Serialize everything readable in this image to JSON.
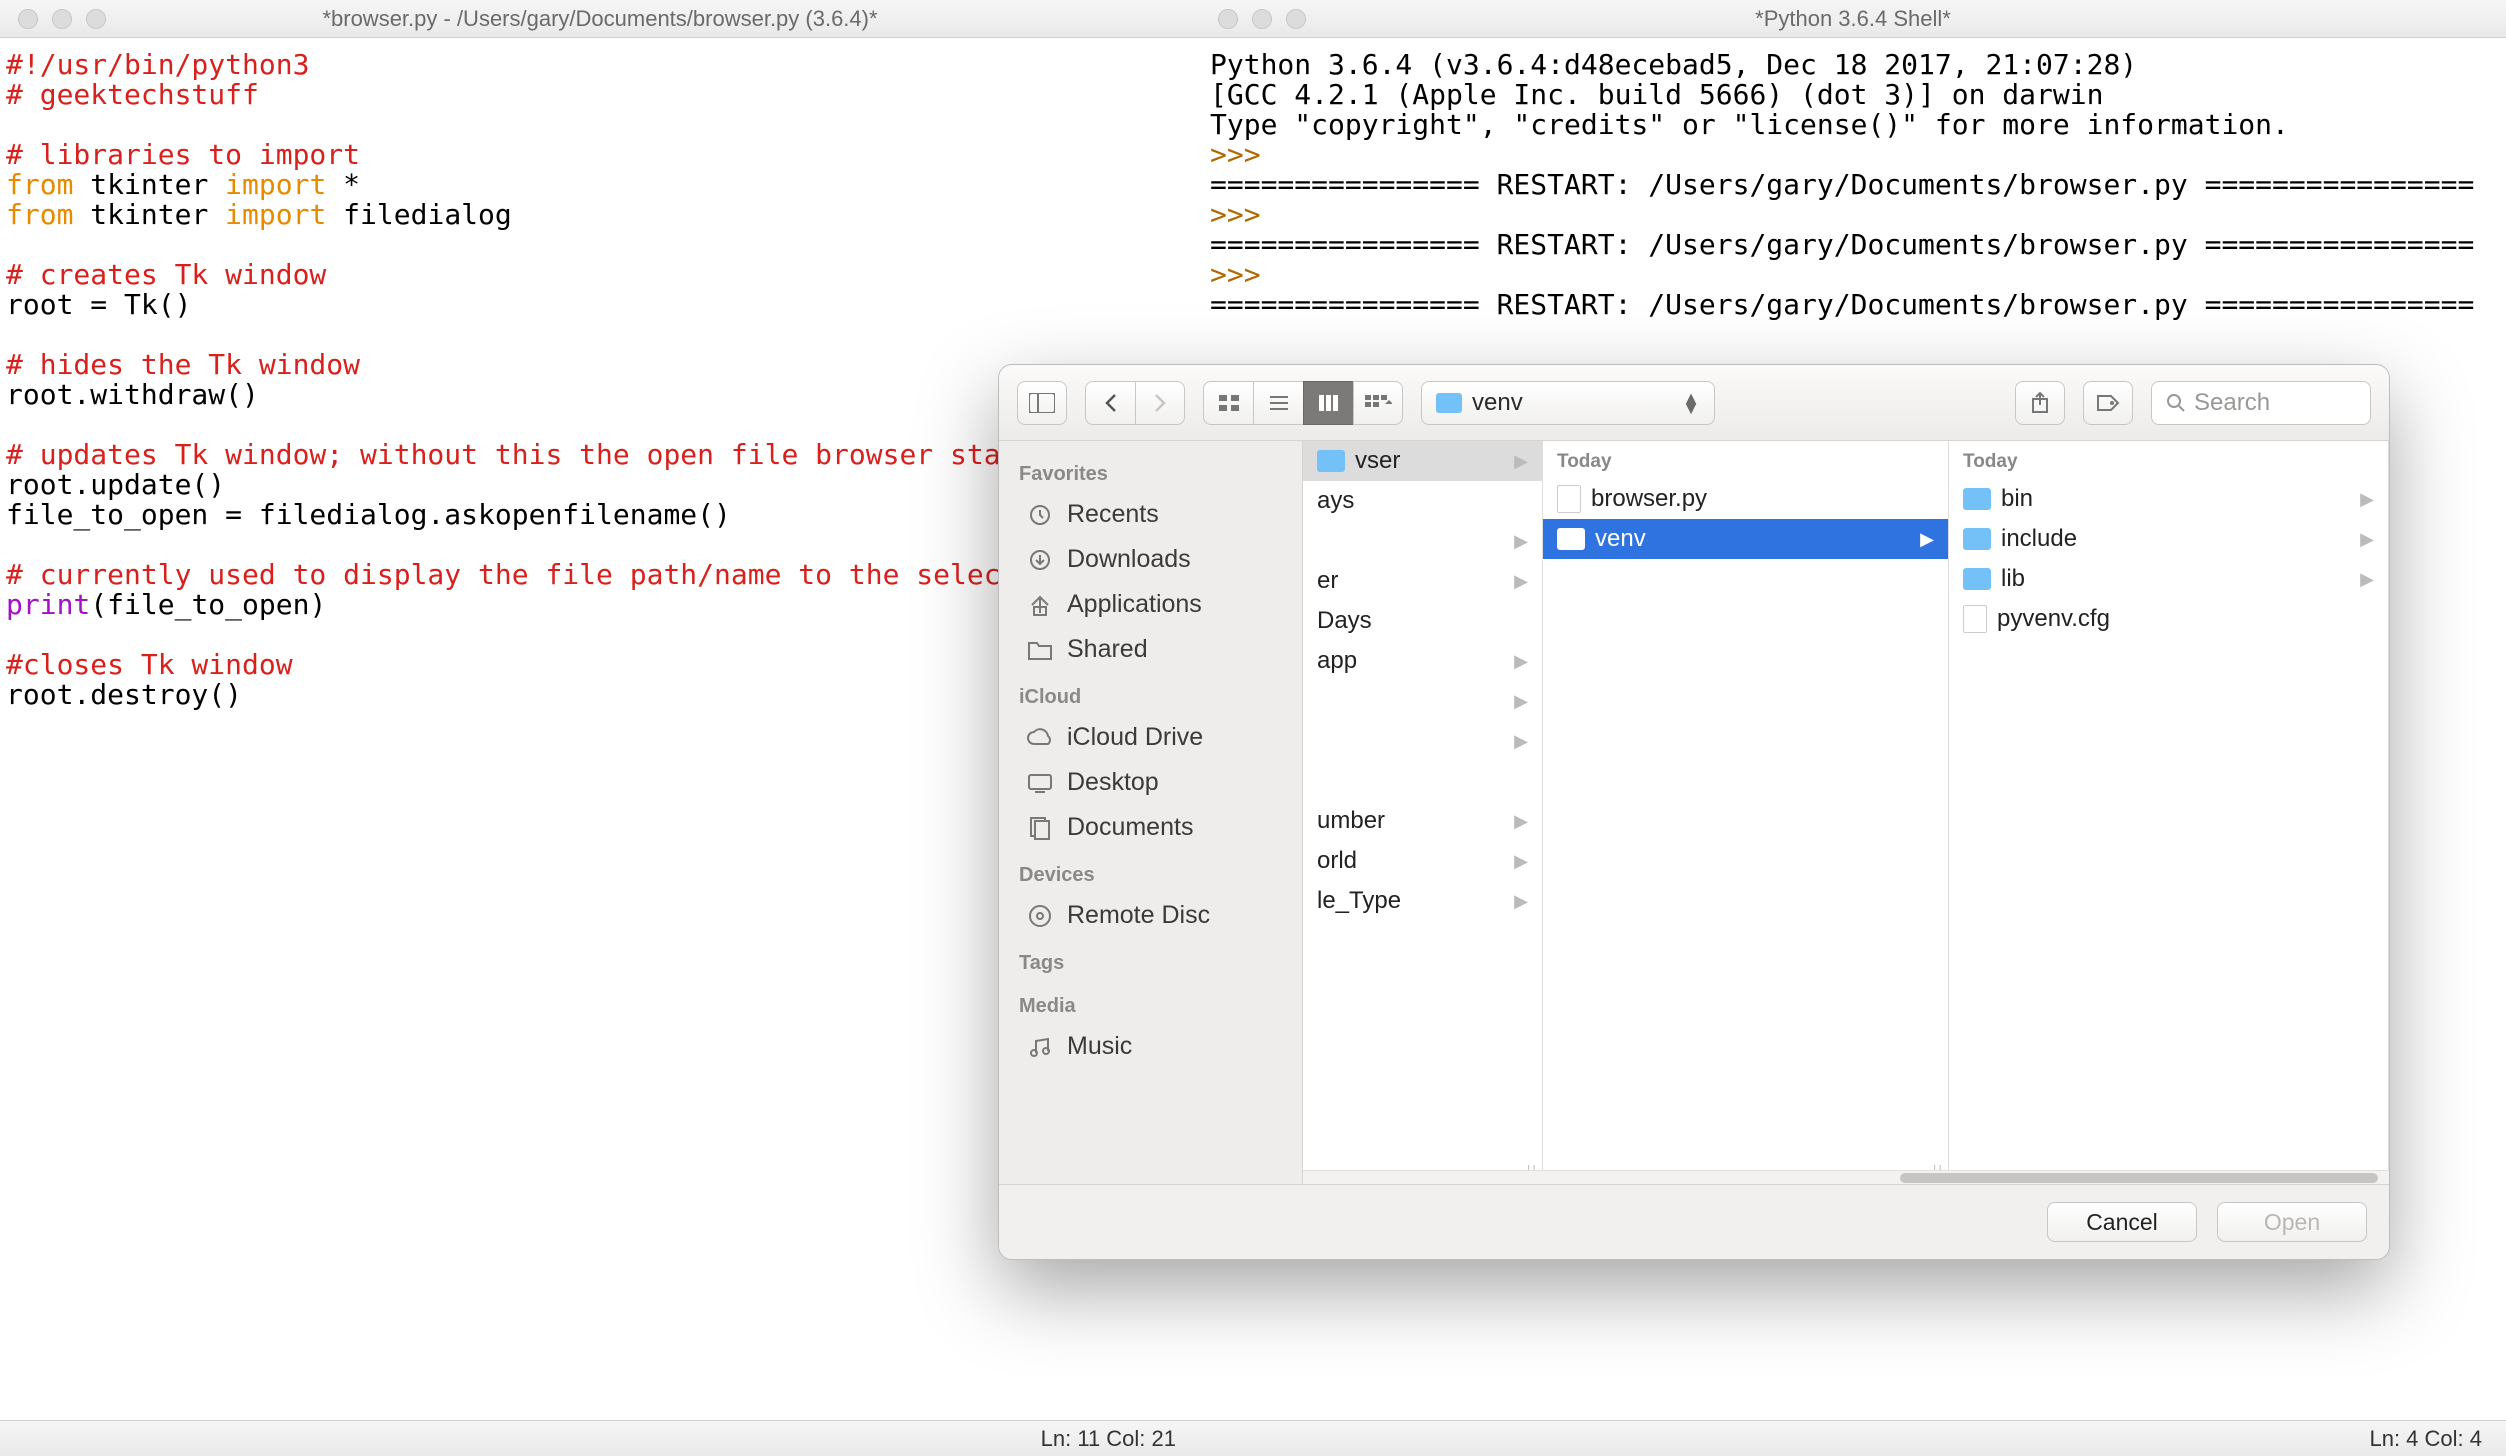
{
  "editor": {
    "title": "*browser.py - /Users/gary/Documents/browser.py (3.6.4)*",
    "status": "Ln: 11  Col: 21",
    "lines": [
      {
        "t": "comment",
        "text": "#!/usr/bin/python3"
      },
      {
        "t": "comment",
        "text": "# geektechstuff"
      },
      {
        "t": "blank",
        "text": ""
      },
      {
        "t": "comment",
        "text": "# libraries to import"
      },
      {
        "t": "import",
        "kw1": "from",
        "mod": "tkinter",
        "kw2": "import",
        "rest": " *"
      },
      {
        "t": "import",
        "kw1": "from",
        "mod": "tkinter",
        "kw2": "import",
        "rest": " filedialog"
      },
      {
        "t": "blank",
        "text": ""
      },
      {
        "t": "comment",
        "text": "# creates Tk window"
      },
      {
        "t": "plain",
        "text": "root = Tk()"
      },
      {
        "t": "blank",
        "text": ""
      },
      {
        "t": "comment",
        "text": "# hides the Tk window"
      },
      {
        "t": "plain",
        "text": "root.withdraw()"
      },
      {
        "t": "blank",
        "text": ""
      },
      {
        "t": "comment",
        "text": "# updates Tk window; without this the open file browser stays open"
      },
      {
        "t": "plain",
        "text": "root.update()"
      },
      {
        "t": "plain",
        "text": "file_to_open = filedialog.askopenfilename()"
      },
      {
        "t": "blank",
        "text": ""
      },
      {
        "t": "comment",
        "text": "# currently used to display the file path/name to the selected file"
      },
      {
        "t": "call",
        "fn": "print",
        "rest": "(file_to_open)"
      },
      {
        "t": "blank",
        "text": ""
      },
      {
        "t": "comment",
        "text": "#closes Tk window"
      },
      {
        "t": "plain",
        "text": "root.destroy()"
      }
    ]
  },
  "shell": {
    "title": "*Python 3.6.4 Shell*",
    "status": "Ln: 4  Col: 4",
    "banner1": "Python 3.6.4 (v3.6.4:d48ecebad5, Dec 18 2017, 21:07:28)",
    "banner2": "[GCC 4.2.1 (Apple Inc. build 5666) (dot 3)] on darwin",
    "banner3": "Type \"copyright\", \"credits\" or \"license()\" for more information.",
    "prompt": ">>> ",
    "restart": "================ RESTART: /Users/gary/Documents/browser.py ================"
  },
  "dialog": {
    "path_label": "venv",
    "search_placeholder": "Search",
    "cancel": "Cancel",
    "open": "Open",
    "sidebar": {
      "groups": [
        {
          "heading": "Favorites",
          "items": [
            {
              "label": "Recents",
              "icon": "clock"
            },
            {
              "label": "Downloads",
              "icon": "download"
            },
            {
              "label": "Applications",
              "icon": "apps"
            },
            {
              "label": "Shared",
              "icon": "folder"
            }
          ]
        },
        {
          "heading": "iCloud",
          "items": [
            {
              "label": "iCloud Drive",
              "icon": "cloud"
            },
            {
              "label": "Desktop",
              "icon": "desktop"
            },
            {
              "label": "Documents",
              "icon": "docs"
            }
          ]
        },
        {
          "heading": "Devices",
          "items": [
            {
              "label": "Remote Disc",
              "icon": "disc"
            }
          ]
        },
        {
          "heading": "Tags",
          "items": []
        },
        {
          "heading": "Media",
          "items": [
            {
              "label": "Music",
              "icon": "music"
            }
          ]
        }
      ]
    },
    "col0": {
      "items": [
        {
          "label": "vser",
          "folder": true,
          "chev": true,
          "sel": "inactive"
        },
        {
          "label": "ays",
          "folder": false
        },
        {
          "label": "",
          "chev": true
        },
        {
          "label": "er",
          "folder": false,
          "chev": true
        },
        {
          "label": "Days",
          "folder": false
        },
        {
          "label": "app",
          "folder": false,
          "chev": true
        },
        {
          "label": "",
          "chev": true
        },
        {
          "label": "",
          "chev": true
        },
        {
          "label": "",
          "folder": false
        },
        {
          "label": "umber",
          "folder": false,
          "chev": true
        },
        {
          "label": "orld",
          "folder": false,
          "chev": true
        },
        {
          "label": "le_Type",
          "folder": false,
          "chev": true
        }
      ]
    },
    "col1": {
      "header": "Today",
      "items": [
        {
          "label": "browser.py",
          "file": true
        },
        {
          "label": "venv",
          "folder": true,
          "chev": true,
          "sel": "active"
        }
      ]
    },
    "col2": {
      "header": "Today",
      "items": [
        {
          "label": "bin",
          "folder": true,
          "chev": true
        },
        {
          "label": "include",
          "folder": true,
          "chev": true
        },
        {
          "label": "lib",
          "folder": true,
          "chev": true
        },
        {
          "label": "pyvenv.cfg",
          "file": true
        }
      ]
    }
  }
}
